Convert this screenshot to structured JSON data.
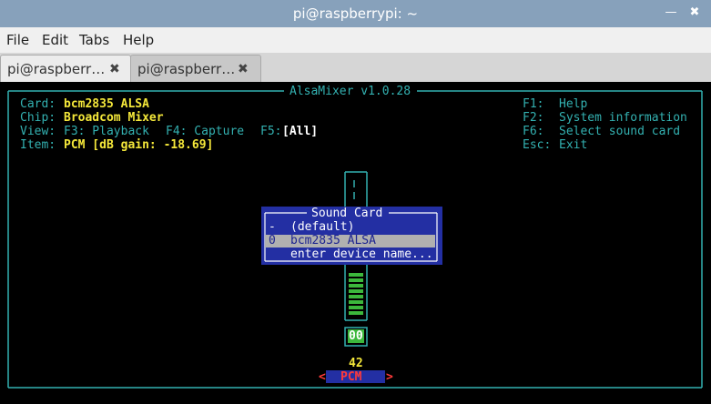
{
  "window": {
    "title": "pi@raspberrypi: ~",
    "minimize_icon": "minimize-icon",
    "close_icon": "close-icon"
  },
  "menu": [
    "File",
    "Edit",
    "Tabs",
    "Help"
  ],
  "tabs": [
    {
      "label": "pi@raspberr…",
      "close": "✖"
    },
    {
      "label": "pi@raspberr…",
      "close": "✖"
    }
  ],
  "alsamixer": {
    "title": "AlsaMixer v1.0.28",
    "card_label": "Card:",
    "card_value": "bcm2835 ALSA",
    "chip_label": "Chip:",
    "chip_value": "Broadcom Mixer",
    "view_label": "View:",
    "view_f3": "F3: Playback",
    "view_f4": "F4: Capture",
    "view_f5": "F5:",
    "view_all": "[All]",
    "item_label": "Item:",
    "item_value": "PCM [dB gain: -18.69]",
    "help": [
      {
        "key": "F1:",
        "text": "Help"
      },
      {
        "key": "F2:",
        "text": "System information"
      },
      {
        "key": "F6:",
        "text": "Select sound card"
      },
      {
        "key": "Esc:",
        "text": "Exit"
      }
    ],
    "channel": {
      "mute_label": "00",
      "volume": "42",
      "name": "PCM",
      "left_arrow": "<",
      "right_arrow": ">"
    },
    "sound_card_dialog": {
      "title": "Sound Card",
      "items": [
        {
          "key": "-",
          "label": "(default)",
          "selected": false
        },
        {
          "key": "0",
          "label": "bcm2835 ALSA",
          "selected": true
        },
        {
          "key": "",
          "label": "enter device name...",
          "selected": false
        }
      ]
    }
  },
  "colors": {
    "titlebar": "#87a1bb",
    "terminal_bg": "#000000",
    "cyan": "#33b1b1",
    "yellow": "#f5e83a",
    "dialog_bg": "#232fa3",
    "meter_green": "#3cb83c",
    "pcm_red": "#ff3a3a"
  }
}
